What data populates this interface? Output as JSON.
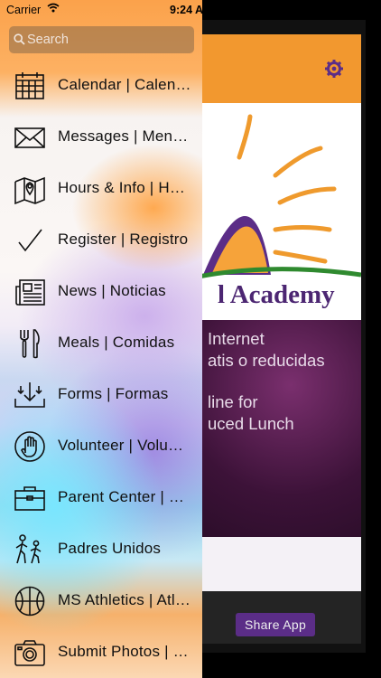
{
  "status_bar": {
    "carrier": "Carrier",
    "time": "9:24 A"
  },
  "search": {
    "placeholder": "Search"
  },
  "menu": [
    {
      "label": "Calendar | Calendario",
      "icon": "calendar-icon"
    },
    {
      "label": "Messages | Mensajes",
      "icon": "envelope-icon"
    },
    {
      "label": "Hours & Info | Horario",
      "icon": "map-icon"
    },
    {
      "label": "Register | Registro",
      "icon": "checkmark-icon"
    },
    {
      "label": "News | Noticias",
      "icon": "newspaper-icon"
    },
    {
      "label": "Meals | Comidas",
      "icon": "utensils-icon"
    },
    {
      "label": "Forms | Formas",
      "icon": "download-tray-icon"
    },
    {
      "label": "Volunteer | Voluntario",
      "icon": "raised-hand-icon"
    },
    {
      "label": "Parent Center | Centro",
      "icon": "briefcase-icon"
    },
    {
      "label": "Padres Unidos",
      "icon": "walking-people-icon"
    },
    {
      "label": "MS Athletics | Atletismo",
      "icon": "basketball-icon"
    },
    {
      "label": "Submit Photos | Fotos",
      "icon": "camera-icon"
    }
  ],
  "background_app": {
    "logo_text": "l Academy",
    "promo_lines": [
      "Internet",
      "atis o reducidas",
      "line for",
      "uced Lunch"
    ],
    "share_button": "Share App"
  },
  "colors": {
    "header_orange": "#f2982f",
    "brand_purple": "#5b2d87",
    "logo_text": "#4c2672"
  }
}
